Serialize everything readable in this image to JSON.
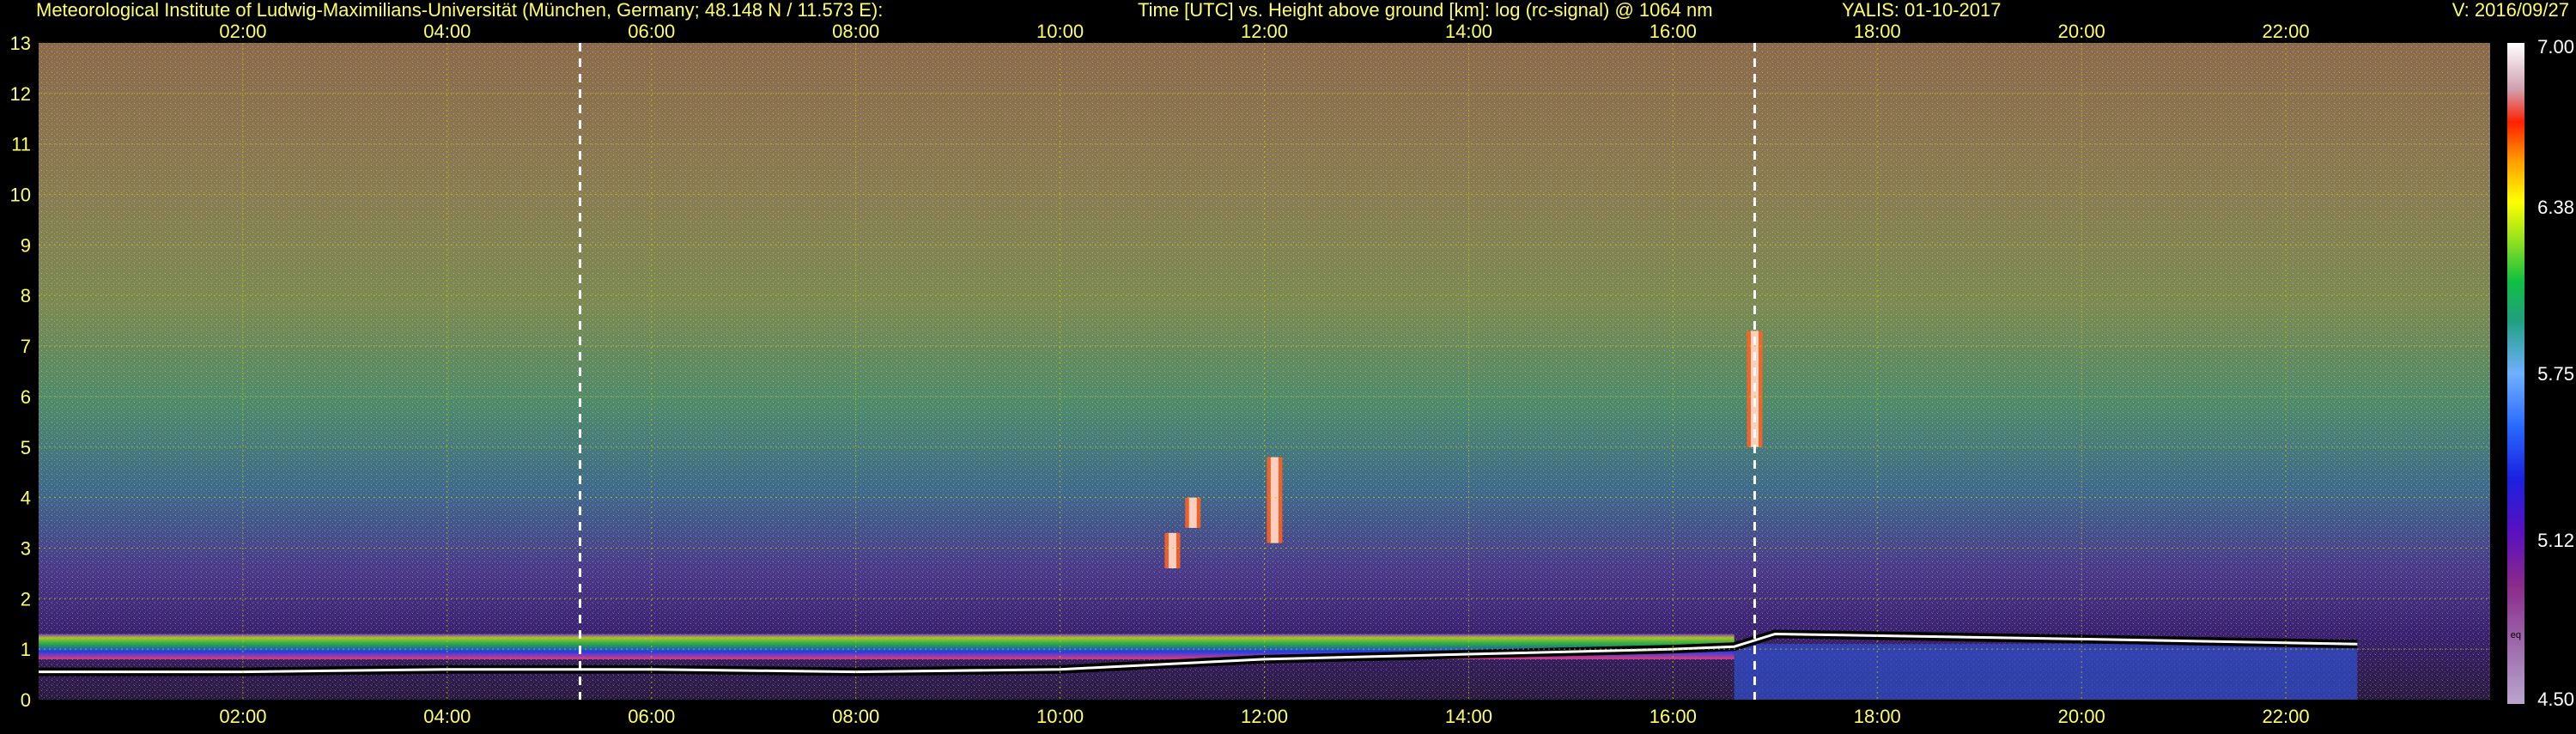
{
  "header": {
    "institute": "Meteorological Institute of Ludwig-Maximilians-Universität (München, Germany; 48.148 N / 11.573 E):",
    "plot_description": "Time [UTC] vs. Height above ground [km]: log (rc-signal) @ 1064 nm",
    "station_date": "YALIS: 01-10-2017",
    "version": "V: 2016/09/27"
  },
  "colors": {
    "background": "#000000",
    "text": "#ffff66",
    "grid": "#c8c800",
    "marker": "#ffffff",
    "colorbar_label": "#ffffff"
  },
  "chart_data": {
    "type": "heatmap",
    "title": "Time [UTC] vs. Height above ground [km]: log (rc-signal) @ 1064 nm",
    "xlabel": "Time [UTC]",
    "ylabel": "Height above ground [km]",
    "x_ticks": [
      "02:00",
      "04:00",
      "06:00",
      "08:00",
      "10:00",
      "12:00",
      "14:00",
      "16:00",
      "18:00",
      "20:00",
      "22:00"
    ],
    "x_tick_hours": [
      2,
      4,
      6,
      8,
      10,
      12,
      14,
      16,
      18,
      20,
      22
    ],
    "xlim": [
      0,
      24
    ],
    "y_ticks": [
      "0",
      "1",
      "2",
      "3",
      "4",
      "5",
      "6",
      "7",
      "8",
      "9",
      "10",
      "11",
      "12",
      "13"
    ],
    "ylim": [
      0,
      13
    ],
    "grid": true,
    "colorbar": {
      "ticks": [
        "4.50",
        "5.12",
        "5.75",
        "6.38",
        "7.00"
      ],
      "values": [
        4.5,
        5.12,
        5.75,
        6.38,
        7.0
      ],
      "range": [
        4.5,
        7.0
      ],
      "small_label": "eq"
    },
    "vertical_markers_hours": [
      5.3,
      16.8
    ],
    "features": {
      "boundary_layer_top_km": [
        {
          "t": 0.0,
          "h": 0.55
        },
        {
          "t": 2.0,
          "h": 0.55
        },
        {
          "t": 4.0,
          "h": 0.6
        },
        {
          "t": 6.0,
          "h": 0.6
        },
        {
          "t": 8.0,
          "h": 0.55
        },
        {
          "t": 10.0,
          "h": 0.6
        },
        {
          "t": 12.0,
          "h": 0.8
        },
        {
          "t": 14.0,
          "h": 0.9
        },
        {
          "t": 16.0,
          "h": 1.0
        },
        {
          "t": 16.6,
          "h": 1.05
        },
        {
          "t": 17.0,
          "h": 1.3
        },
        {
          "t": 20.0,
          "h": 1.2
        },
        {
          "t": 22.7,
          "h": 1.1
        }
      ],
      "aerosol_layer_km": {
        "bottom": 0.8,
        "top": 1.3,
        "t_start": 0.0,
        "t_end": 16.6
      },
      "clouds": [
        {
          "t": 11.1,
          "h_bottom": 2.6,
          "h_top": 3.3
        },
        {
          "t": 11.3,
          "h_bottom": 3.4,
          "h_top": 4.0
        },
        {
          "t": 12.1,
          "h_bottom": 3.1,
          "h_top": 4.8
        },
        {
          "t": 16.8,
          "h_bottom": 5.0,
          "h_top": 7.3
        }
      ]
    }
  }
}
